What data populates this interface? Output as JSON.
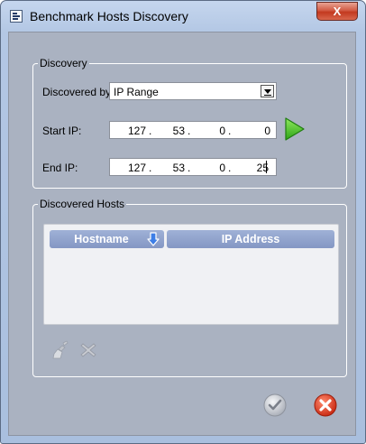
{
  "window": {
    "title": "Benchmark Hosts Discovery",
    "close_glyph": "X"
  },
  "discovery": {
    "legend": "Discovery",
    "discovered_by_label": "Discovered by:",
    "discovered_by_value": "IP Range",
    "start_ip_label": "Start IP:",
    "start_ip": [
      "127",
      "53",
      "0",
      "0"
    ],
    "end_ip_label": "End  IP:",
    "end_ip": [
      "127",
      "53",
      "0",
      "25"
    ],
    "separator": ".",
    "go_icon": "play-arrow-icon"
  },
  "hosts": {
    "legend": "Discovered Hosts",
    "columns": [
      "Hostname",
      "IP Address"
    ],
    "sort_icon": "sort-down-arrow-icon",
    "rows": [],
    "tools": [
      "clear-broom-icon",
      "remove-x-icon"
    ]
  },
  "footer": {
    "ok_icon": "checkmark-icon",
    "cancel_icon": "cancel-x-icon"
  },
  "colors": {
    "accent_green": "#35b21e",
    "cancel_red": "#d8331c",
    "column_header": "#8d9fcb"
  }
}
